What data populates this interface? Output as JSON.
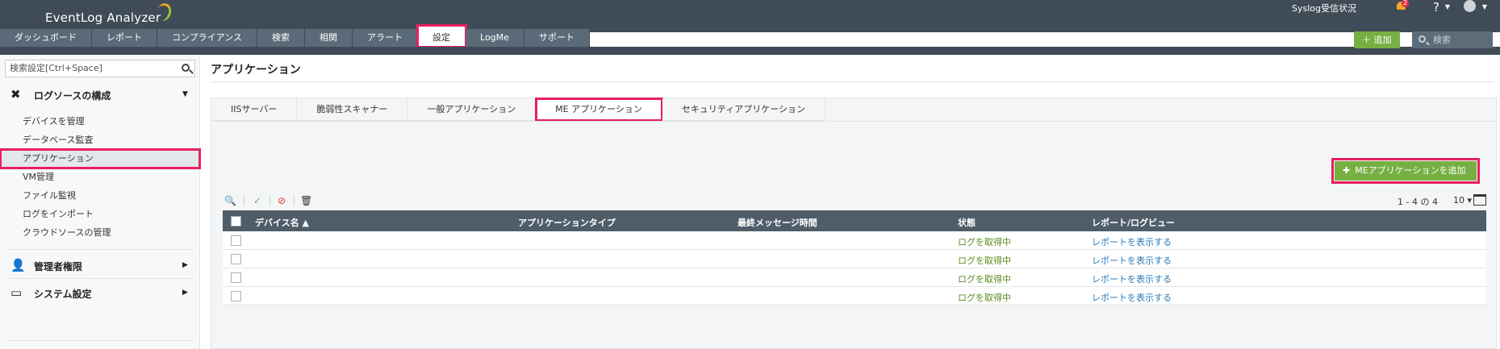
{
  "app": {
    "title": "EventLog Analyzer"
  },
  "topbar": {
    "syslog_status": "Syslog受信状況",
    "notification_count": "2",
    "help": "?"
  },
  "nav": {
    "tabs": [
      "ダッシュボード",
      "レポート",
      "コンプライアンス",
      "検索",
      "相関",
      "アラート",
      "設定",
      "LogMe",
      "サポート"
    ],
    "active": "設定"
  },
  "header_actions": {
    "add_label": "追加",
    "search_placeholder": "検索"
  },
  "sidebar": {
    "search_placeholder": "検索設定[Ctrl+Space]",
    "sections": [
      {
        "label": "ログソースの構成",
        "icon": "tools-icon",
        "expanded": true
      },
      {
        "label": "管理者権限",
        "icon": "user-gear-icon",
        "expanded": false
      },
      {
        "label": "システム設定",
        "icon": "monitor-gear-icon",
        "expanded": false
      }
    ],
    "items": [
      "デバイスを管理",
      "データベース監査",
      "アプリケーション",
      "VM管理",
      "ファイル監視",
      "ログをインポート",
      "クラウドソースの管理"
    ],
    "active_item": "アプリケーション"
  },
  "main": {
    "title": "アプリケーション",
    "subtabs": [
      "IISサーバー",
      "脆弱性スキャナー",
      "一般アプリケーション",
      "ME アプリケーション",
      "セキュリティアプリケーション"
    ],
    "active_subtab": "ME アプリケーション",
    "add_me_button": "MEアプリケーションを追加",
    "pager": {
      "range": "1 - 4 の 4",
      "per_page": "10"
    },
    "columns": [
      "デバイス名",
      "アプリケーションタイプ",
      "最終メッセージ時間",
      "状態",
      "レポート/ログビュー"
    ],
    "rows": [
      {
        "device": "",
        "type": "",
        "last_message": "",
        "status": "ログを取得中",
        "report": "レポートを表示する"
      },
      {
        "device": "",
        "type": "",
        "last_message": "",
        "status": "ログを取得中",
        "report": "レポートを表示する"
      },
      {
        "device": "",
        "type": "",
        "last_message": "",
        "status": "ログを取得中",
        "report": "レポートを表示する"
      },
      {
        "device": "",
        "type": "",
        "last_message": "",
        "status": "ログを取得中",
        "report": "レポートを表示する"
      }
    ]
  },
  "colors": {
    "topbar": "#3f4b56",
    "accent_green": "#76b043",
    "highlight": "#e91e63",
    "link": "#2a7ab8"
  }
}
